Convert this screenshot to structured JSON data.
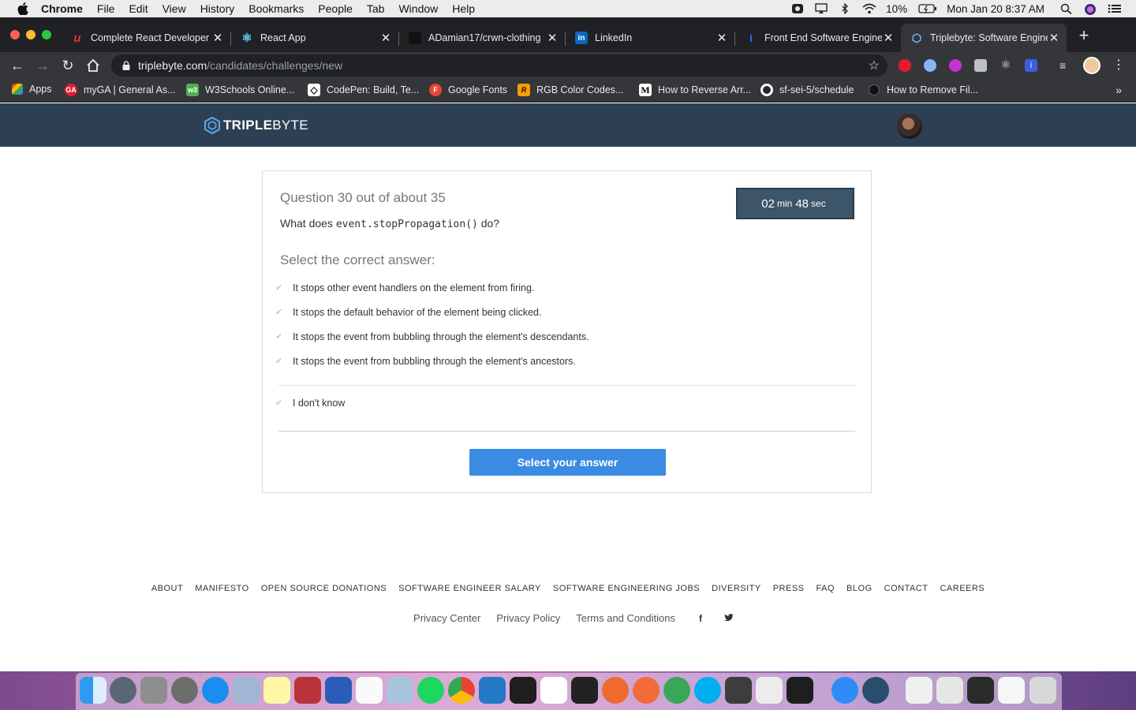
{
  "menubar": {
    "app": "Chrome",
    "items": [
      "File",
      "Edit",
      "View",
      "History",
      "Bookmarks",
      "People",
      "Tab",
      "Window",
      "Help"
    ],
    "battery": "10%",
    "clock": "Mon Jan 20  8:37 AM"
  },
  "tabs": [
    {
      "title": "Complete React Developer",
      "favicon_color": "#d62f2f",
      "favicon_text": "u"
    },
    {
      "title": "React App",
      "favicon_color": "#1d2a38",
      "favicon_text": "⚛"
    },
    {
      "title": "ADamian17/crwn-clothing",
      "favicon_color": "#161616",
      "favicon_text": ""
    },
    {
      "title": "LinkedIn",
      "favicon_color": "#0a66c2",
      "favicon_text": "in"
    },
    {
      "title": "Front End Software Enginee",
      "favicon_color": "#2b4fd6",
      "favicon_text": "i"
    },
    {
      "title": "Triplebyte: Software Engine",
      "favicon_color": "#2d4053",
      "favicon_text": "⬡",
      "active": true
    }
  ],
  "toolbar": {
    "url_host": "triplebyte.com",
    "url_path": "/candidates/challenges/new"
  },
  "bookmarks": [
    {
      "label": "Apps",
      "color": "#4285f4",
      "text": "⋮"
    },
    {
      "label": "myGA | General As...",
      "color": "#e11d2f",
      "text": "GA"
    },
    {
      "label": "W3Schools Online...",
      "color": "#4caf50",
      "text": "w3"
    },
    {
      "label": "CodePen: Build, Te...",
      "color": "#1e1f26",
      "text": "◇"
    },
    {
      "label": "Google Fonts",
      "color": "#ea4335",
      "text": "F"
    },
    {
      "label": "RGB Color Codes...",
      "color": "#f4a000",
      "text": "R"
    },
    {
      "label": "How to Reverse Arr...",
      "color": "#000000",
      "text": "M"
    },
    {
      "label": "sf-sei-5/schedule",
      "color": "#24292e",
      "text": "●"
    },
    {
      "label": "How to Remove Fil...",
      "color": "#111111",
      "text": "⬢"
    }
  ],
  "site": {
    "logo_bold": "TRIPLE",
    "logo_rest": "BYTE"
  },
  "question": {
    "header": "Question 30 out of about 35",
    "prefix": "What does ",
    "code": "event.stopPropagation()",
    "suffix": " do?",
    "timer_min": "02",
    "timer_min_label": "min",
    "timer_sec": "48",
    "timer_sec_label": "sec",
    "select_header": "Select the correct answer:",
    "options": [
      "It stops other event handlers on the element from firing.",
      "It stops the default behavior of the element being clicked.",
      "It stops the event from bubbling through the element's descendants.",
      "It stops the event from bubbling through the element's ancestors."
    ],
    "dont_know": "I don't know",
    "submit_label": "Select your answer"
  },
  "footer": {
    "links": [
      "ABOUT",
      "MANIFESTO",
      "OPEN SOURCE DONATIONS",
      "SOFTWARE ENGINEER SALARY",
      "SOFTWARE ENGINEERING JOBS",
      "DIVERSITY",
      "PRESS",
      "FAQ",
      "BLOG",
      "CONTACT",
      "CAREERS"
    ],
    "legal": [
      "Privacy Center",
      "Privacy Policy",
      "Terms and Conditions"
    ],
    "social": [
      "facebook-icon",
      "twitter-icon"
    ]
  },
  "dock_apps": [
    "finder",
    "launchpad",
    "system-utility",
    "system-preferences",
    "app-store",
    "preview",
    "notes",
    "dictionary",
    "word",
    "calendar",
    "photos",
    "spotify",
    "chrome",
    "vscode",
    "terminal",
    "slack",
    "activity-monitor",
    "sublime",
    "postman",
    "robo3t",
    "skype",
    "printer",
    "textedit",
    "figma",
    "messages",
    "quicktime",
    "window-1",
    "window-2",
    "window-3",
    "window-4",
    "trash"
  ],
  "colors": {
    "header_bg": "#2d4053",
    "timer_bg": "#3d5568",
    "submit_bg": "#3b8be3"
  }
}
